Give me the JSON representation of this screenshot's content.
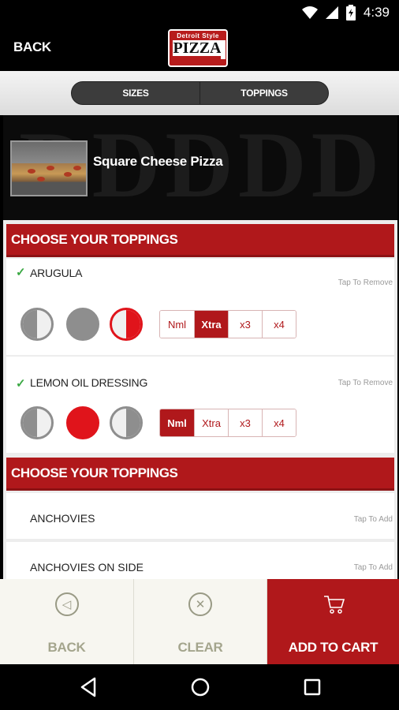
{
  "status_bar": {
    "time": "4:39"
  },
  "header": {
    "back_label": "BACK",
    "logo_top": "Detroit Style",
    "logo_main": "PIZZA",
    "logo_side": "Company"
  },
  "tabs": [
    {
      "label": "SIZES"
    },
    {
      "label": "TOPPINGS"
    }
  ],
  "item": {
    "name": "Square Cheese Pizza"
  },
  "sections": [
    {
      "title": "CHOOSE YOUR TOPPINGS"
    },
    {
      "title": "CHOOSE YOUR TOPPINGS"
    }
  ],
  "selected_toppings": [
    {
      "name": "ARUGULA",
      "action": "Tap To Remove",
      "portion": "right-half",
      "amount": "Xtra",
      "amount_options": [
        "Nml",
        "Xtra",
        "x3",
        "x4"
      ]
    },
    {
      "name": "LEMON OIL DRESSING",
      "action": "Tap To Remove",
      "portion": "whole",
      "amount": "Nml",
      "amount_options": [
        "Nml",
        "Xtra",
        "x3",
        "x4"
      ]
    }
  ],
  "available_toppings": [
    {
      "name": "ANCHOVIES",
      "action": "Tap To Add"
    },
    {
      "name": "ANCHOVIES ON SIDE",
      "action": "Tap To Add"
    }
  ],
  "bottom_bar": {
    "back_label": "BACK",
    "clear_label": "CLEAR",
    "add_to_cart_label": "ADD TO CART"
  },
  "colors": {
    "brand_red": "#b0181b",
    "selected_red": "#e0141b",
    "check_green": "#3aa843"
  }
}
